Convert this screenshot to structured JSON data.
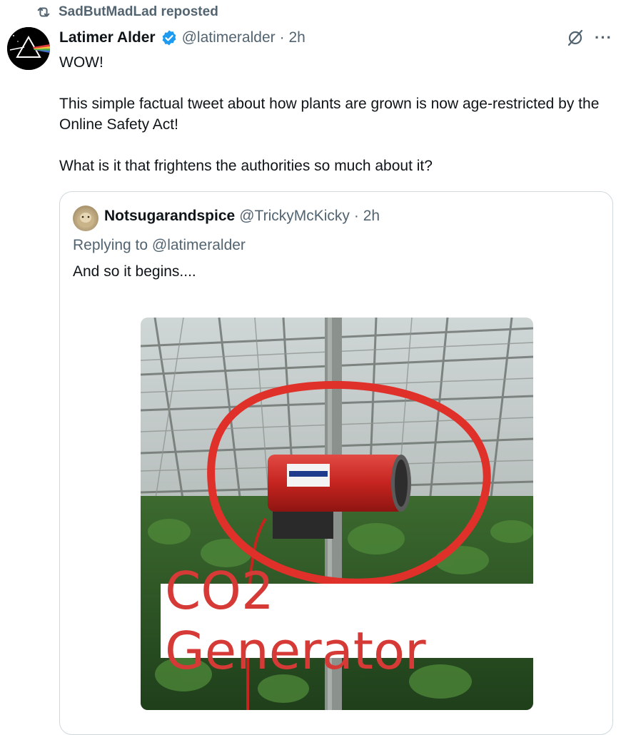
{
  "repost": {
    "label": "SadButMadLad reposted",
    "icon": "repost-icon"
  },
  "post": {
    "author_name": "Latimer Alder",
    "handle": "@latimeralder",
    "time": "· 2h",
    "paragraphs": [
      "WOW!",
      "This simple factual tweet about how plants are grown is now age-restricted by the Online Safety Act!",
      "What is it that frightens the authorities so much about it?"
    ]
  },
  "quote": {
    "author_name": "Notsugarandspice",
    "handle": "@TrickyMcKicky",
    "time": "· 2h",
    "replying_to": "Replying to @latimeralder",
    "text": "And so it begins....",
    "media_caption": "CO2 Generator"
  },
  "colors": {
    "secondary_text": "#536471",
    "verified": "#1d9bf0",
    "border": "#cfd9de",
    "caption_red": "#d63a36"
  }
}
